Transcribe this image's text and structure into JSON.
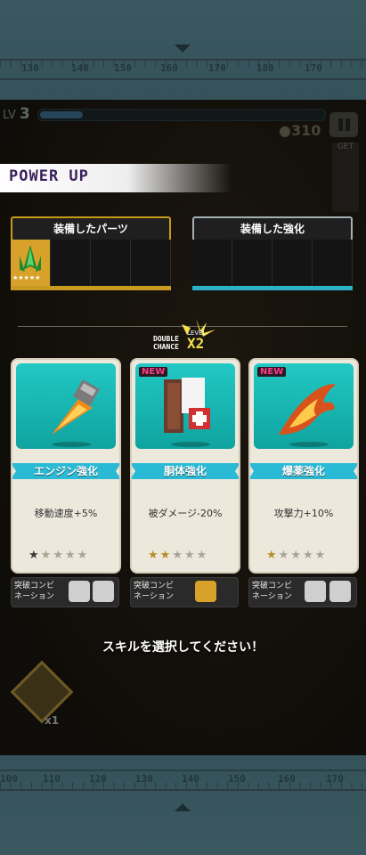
{
  "top_ruler": {
    "labels": [
      "130",
      "140",
      "150",
      "160",
      "170",
      "180",
      "170"
    ]
  },
  "bottom_ruler": {
    "labels": [
      "100",
      "110",
      "120",
      "130",
      "140",
      "150",
      "160",
      "170"
    ]
  },
  "hud": {
    "level_prefix": "LV",
    "level": "3",
    "coins": "310",
    "xp_fraction": 0.15,
    "get_label": "GET"
  },
  "title": "POWER UP",
  "equipped_parts": {
    "header": "装備したパーツ",
    "slot_stars": "★★★★★"
  },
  "equipped_boosts": {
    "header": "装備した強化"
  },
  "double_chance": {
    "line1": "DOUBLE",
    "line2": "CHANCE",
    "level": "LEVEL",
    "mult": "X2"
  },
  "cards": [
    {
      "new": "",
      "name": "エンジン強化",
      "desc": "移動速度+5%",
      "stars_filled": 1,
      "stars_total": 5,
      "combo": "突破コンビネーション",
      "combo_line1": "突破コンビ",
      "combo_line2": "ネーション"
    },
    {
      "new": "NEW",
      "name": "胴体強化",
      "desc": "被ダメージ-20%",
      "stars_filled": 2,
      "stars_total": 5,
      "combo": "突破コンビネーション",
      "combo_line1": "突破コンビ",
      "combo_line2": "ネーション"
    },
    {
      "new": "NEW",
      "name": "爆薬強化",
      "desc": "攻撃力+10%",
      "stars_filled": 1,
      "stars_total": 5,
      "combo": "突破コンビネーション",
      "combo_line1": "突破コンビ",
      "combo_line2": "ネーション"
    }
  ],
  "prompt": "スキルを選択してください！",
  "bomb": {
    "count": "x1"
  },
  "colors": {
    "accent_gold": "#c99a22",
    "accent_cyan": "#2db1c9",
    "card_teal": "#16b3ae"
  }
}
